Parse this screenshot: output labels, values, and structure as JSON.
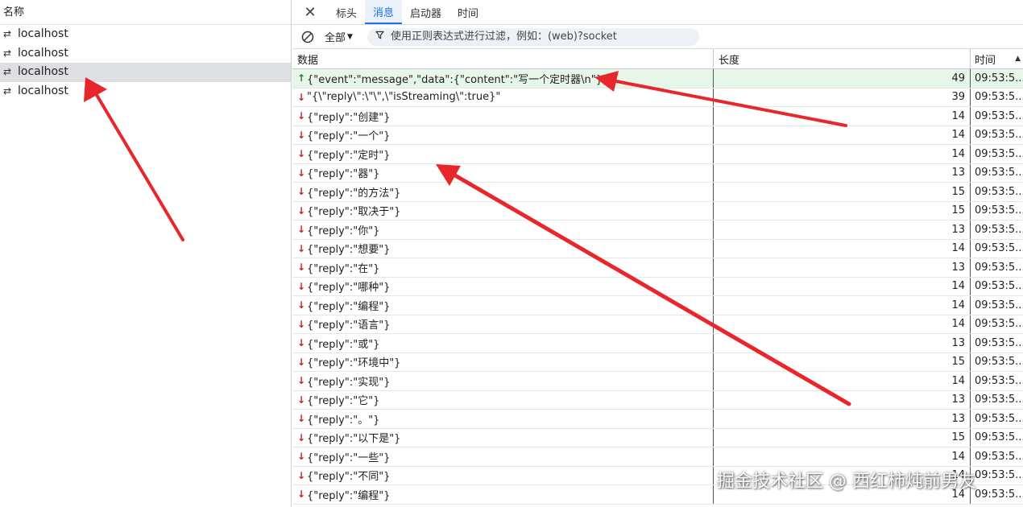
{
  "left_pane": {
    "header": "名称",
    "requests": [
      {
        "name": "localhost",
        "selected": false
      },
      {
        "name": "localhost",
        "selected": false
      },
      {
        "name": "localhost",
        "selected": true
      },
      {
        "name": "localhost",
        "selected": false
      }
    ]
  },
  "tabs": [
    "标头",
    "消息",
    "启动器",
    "时间"
  ],
  "active_tab": "消息",
  "filter": {
    "type_label": "全部",
    "placeholder": "使用正则表达式进行过滤，例如：(web)?socket"
  },
  "table": {
    "headers": {
      "data": "数据",
      "length": "长度",
      "time": "时间"
    },
    "rows": [
      {
        "dir": "up",
        "data": "{\"event\":\"message\",\"data\":{\"content\":\"写一个定时器\\n\"}}",
        "length": "49",
        "time": "09:53:5..."
      },
      {
        "dir": "down",
        "data": "\"{\\\"reply\\\":\\\"\\\",\\\"isStreaming\\\":true}\"",
        "length": "39",
        "time": "09:53:5..."
      },
      {
        "dir": "down",
        "data": "{\"reply\":\"创建\"}",
        "length": "14",
        "time": "09:53:5..."
      },
      {
        "dir": "down",
        "data": "{\"reply\":\"一个\"}",
        "length": "14",
        "time": "09:53:5..."
      },
      {
        "dir": "down",
        "data": "{\"reply\":\"定时\"}",
        "length": "14",
        "time": "09:53:5..."
      },
      {
        "dir": "down",
        "data": "{\"reply\":\"器\"}",
        "length": "13",
        "time": "09:53:5..."
      },
      {
        "dir": "down",
        "data": "{\"reply\":\"的方法\"}",
        "length": "15",
        "time": "09:53:5..."
      },
      {
        "dir": "down",
        "data": "{\"reply\":\"取决于\"}",
        "length": "15",
        "time": "09:53:5..."
      },
      {
        "dir": "down",
        "data": "{\"reply\":\"你\"}",
        "length": "13",
        "time": "09:53:5..."
      },
      {
        "dir": "down",
        "data": "{\"reply\":\"想要\"}",
        "length": "14",
        "time": "09:53:5..."
      },
      {
        "dir": "down",
        "data": "{\"reply\":\"在\"}",
        "length": "13",
        "time": "09:53:5..."
      },
      {
        "dir": "down",
        "data": "{\"reply\":\"哪种\"}",
        "length": "14",
        "time": "09:53:5..."
      },
      {
        "dir": "down",
        "data": "{\"reply\":\"编程\"}",
        "length": "14",
        "time": "09:53:5..."
      },
      {
        "dir": "down",
        "data": "{\"reply\":\"语言\"}",
        "length": "14",
        "time": "09:53:5..."
      },
      {
        "dir": "down",
        "data": "{\"reply\":\"或\"}",
        "length": "13",
        "time": "09:53:5..."
      },
      {
        "dir": "down",
        "data": "{\"reply\":\"环境中\"}",
        "length": "15",
        "time": "09:53:5..."
      },
      {
        "dir": "down",
        "data": "{\"reply\":\"实现\"}",
        "length": "14",
        "time": "09:53:5..."
      },
      {
        "dir": "down",
        "data": "{\"reply\":\"它\"}",
        "length": "13",
        "time": "09:53:5..."
      },
      {
        "dir": "down",
        "data": "{\"reply\":\"。\"}",
        "length": "13",
        "time": "09:53:5..."
      },
      {
        "dir": "down",
        "data": "{\"reply\":\"以下是\"}",
        "length": "15",
        "time": "09:53:5..."
      },
      {
        "dir": "down",
        "data": "{\"reply\":\"一些\"}",
        "length": "14",
        "time": "09:53:5..."
      },
      {
        "dir": "down",
        "data": "{\"reply\":\"不同\"}",
        "length": "14",
        "time": "09:53:5..."
      },
      {
        "dir": "down",
        "data": "{\"reply\":\"编程\"}",
        "length": "14",
        "time": "09:53:5..."
      }
    ]
  },
  "watermark": "掘金技术社区 @ 西红柿炖前男友",
  "colors": {
    "active_tab": "#1a73e8",
    "sent_row_bg": "#e6f6e8",
    "sent_arrow": "#188038",
    "received_arrow": "#c5221f",
    "annotation_arrow": "#e8262b"
  },
  "icons": {
    "request_icon": "websocket-arrows-icon",
    "close": "close-icon",
    "clear": "block-icon",
    "filter": "filter-funnel-icon",
    "sort": "sort-ascending-icon"
  }
}
